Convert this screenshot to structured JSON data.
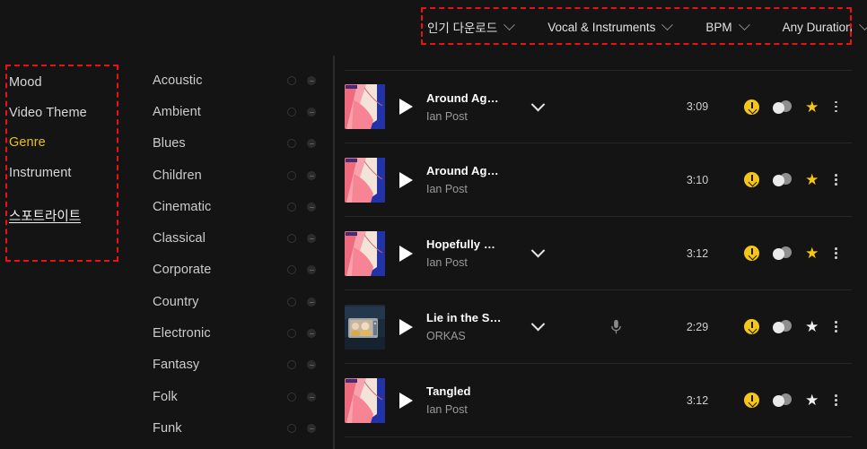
{
  "left_nav": {
    "items": [
      {
        "label": "Mood",
        "active": false
      },
      {
        "label": "Video Theme",
        "active": false
      },
      {
        "label": "Genre",
        "active": true
      },
      {
        "label": "Instrument",
        "active": false
      }
    ],
    "spotlight_label": "스포트라이트",
    "active_color": "#e8c20a",
    "highlight_box_color": "#ee1111"
  },
  "genre_panel": {
    "items": [
      {
        "label": "Acoustic",
        "add_icon": "plus-circle-icon",
        "remove_icon": "minus-circle-icon"
      },
      {
        "label": "Ambient",
        "add_icon": "plus-circle-icon",
        "remove_icon": "minus-circle-icon"
      },
      {
        "label": "Blues",
        "add_icon": "plus-circle-icon",
        "remove_icon": "minus-circle-icon"
      },
      {
        "label": "Children",
        "add_icon": "plus-circle-icon",
        "remove_icon": "minus-circle-icon"
      },
      {
        "label": "Cinematic",
        "add_icon": "plus-circle-icon",
        "remove_icon": "minus-circle-icon"
      },
      {
        "label": "Classical",
        "add_icon": "plus-circle-icon",
        "remove_icon": "minus-circle-icon"
      },
      {
        "label": "Corporate",
        "add_icon": "plus-circle-icon",
        "remove_icon": "minus-circle-icon"
      },
      {
        "label": "Country",
        "add_icon": "plus-circle-icon",
        "remove_icon": "minus-circle-icon"
      },
      {
        "label": "Electronic",
        "add_icon": "plus-circle-icon",
        "remove_icon": "minus-circle-icon"
      },
      {
        "label": "Fantasy",
        "add_icon": "plus-circle-icon",
        "remove_icon": "minus-circle-icon"
      },
      {
        "label": "Folk",
        "add_icon": "plus-circle-icon",
        "remove_icon": "minus-circle-icon"
      },
      {
        "label": "Funk",
        "add_icon": "plus-circle-icon",
        "remove_icon": "minus-circle-icon"
      }
    ]
  },
  "filter_bar": {
    "highlight_box_color": "#ee1111",
    "filters": [
      {
        "label": "인기 다운로드",
        "icon": "chevron-down-icon"
      },
      {
        "label": "Vocal & Instruments",
        "icon": "chevron-down-icon"
      },
      {
        "label": "BPM",
        "icon": "chevron-down-icon"
      },
      {
        "label": "Any Duration",
        "icon": "chevron-down-icon"
      }
    ]
  },
  "track_list": {
    "download_icon_color": "#f5c518",
    "star_on_color": "#f5c518",
    "tracks": [
      {
        "title": "Around Ag…",
        "artist": "Ian Post",
        "duration": "3:09",
        "artwork": "abstract-pink-blue",
        "has_variants": true,
        "has_vocal": false,
        "favorited": true
      },
      {
        "title": "Around Ag…",
        "artist": "Ian Post",
        "duration": "3:10",
        "artwork": "abstract-pink-blue",
        "has_variants": false,
        "has_vocal": false,
        "favorited": true
      },
      {
        "title": "Hopefully …",
        "artist": "Ian Post",
        "duration": "3:12",
        "artwork": "abstract-pink-blue",
        "has_variants": true,
        "has_vocal": false,
        "favorited": true
      },
      {
        "title": "Lie in the S…",
        "artist": "ORKAS",
        "duration": "2:29",
        "artwork": "tv-photo-blue",
        "has_variants": true,
        "has_vocal": true,
        "favorited": false
      },
      {
        "title": "Tangled",
        "artist": "Ian Post",
        "duration": "3:12",
        "artwork": "abstract-pink-blue",
        "has_variants": false,
        "has_vocal": false,
        "favorited": false
      }
    ]
  }
}
